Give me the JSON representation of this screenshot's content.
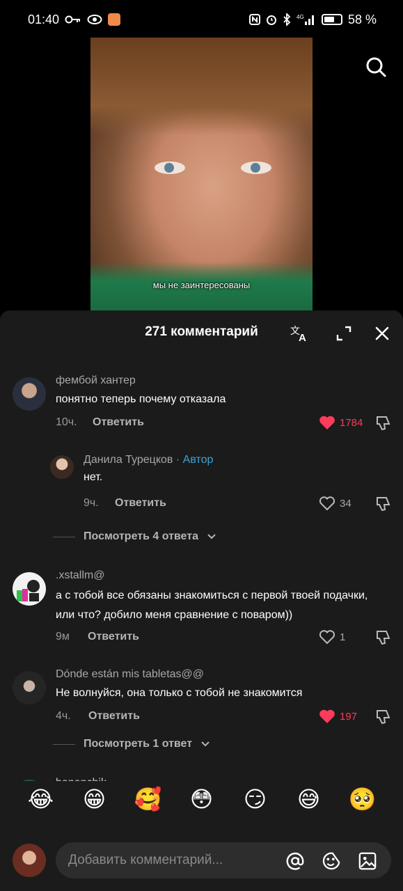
{
  "status": {
    "time": "01:40",
    "battery": "58 %",
    "network": "4G"
  },
  "video": {
    "subtitle": "мы не заинтересованы"
  },
  "panel": {
    "title": "271 комментарий"
  },
  "comments": [
    {
      "name": "фембой хантер",
      "text": "понятно теперь почему отказала",
      "time": "10ч.",
      "reply": "Ответить",
      "likes": "1784",
      "liked": true
    },
    {
      "name": "Данила Турецков",
      "author_tag": "· Автор",
      "text": "нет.",
      "time": "9ч.",
      "reply": "Ответить",
      "likes": "34",
      "liked": false
    },
    {
      "name": ".xstallm@",
      "text": "а с тобой все обязаны знакомиться с первой твоей подачки, или что? добило меня сравнение с поваром))",
      "time": "9м",
      "reply": "Ответить",
      "likes": "1",
      "liked": false
    },
    {
      "name": "Dónde están mis tabletas@@",
      "text": "Не волнуйся, она только с тобой не знакомится",
      "time": "4ч.",
      "reply": "Ответить",
      "likes": "197",
      "liked": true
    },
    {
      "name": "bananchik"
    }
  ],
  "view_replies": [
    "Посмотреть 4 ответа",
    "Посмотреть 1 ответ"
  ],
  "emojis": [
    "😂",
    "😁",
    "🥰",
    "😳",
    "😏",
    "😅",
    "🥺"
  ],
  "input": {
    "placeholder": "Добавить комментарий..."
  },
  "colors": {
    "panel_bg": "#1b1b1b",
    "like_red": "#ff3b5c",
    "author_blue": "#3fa3d6"
  }
}
